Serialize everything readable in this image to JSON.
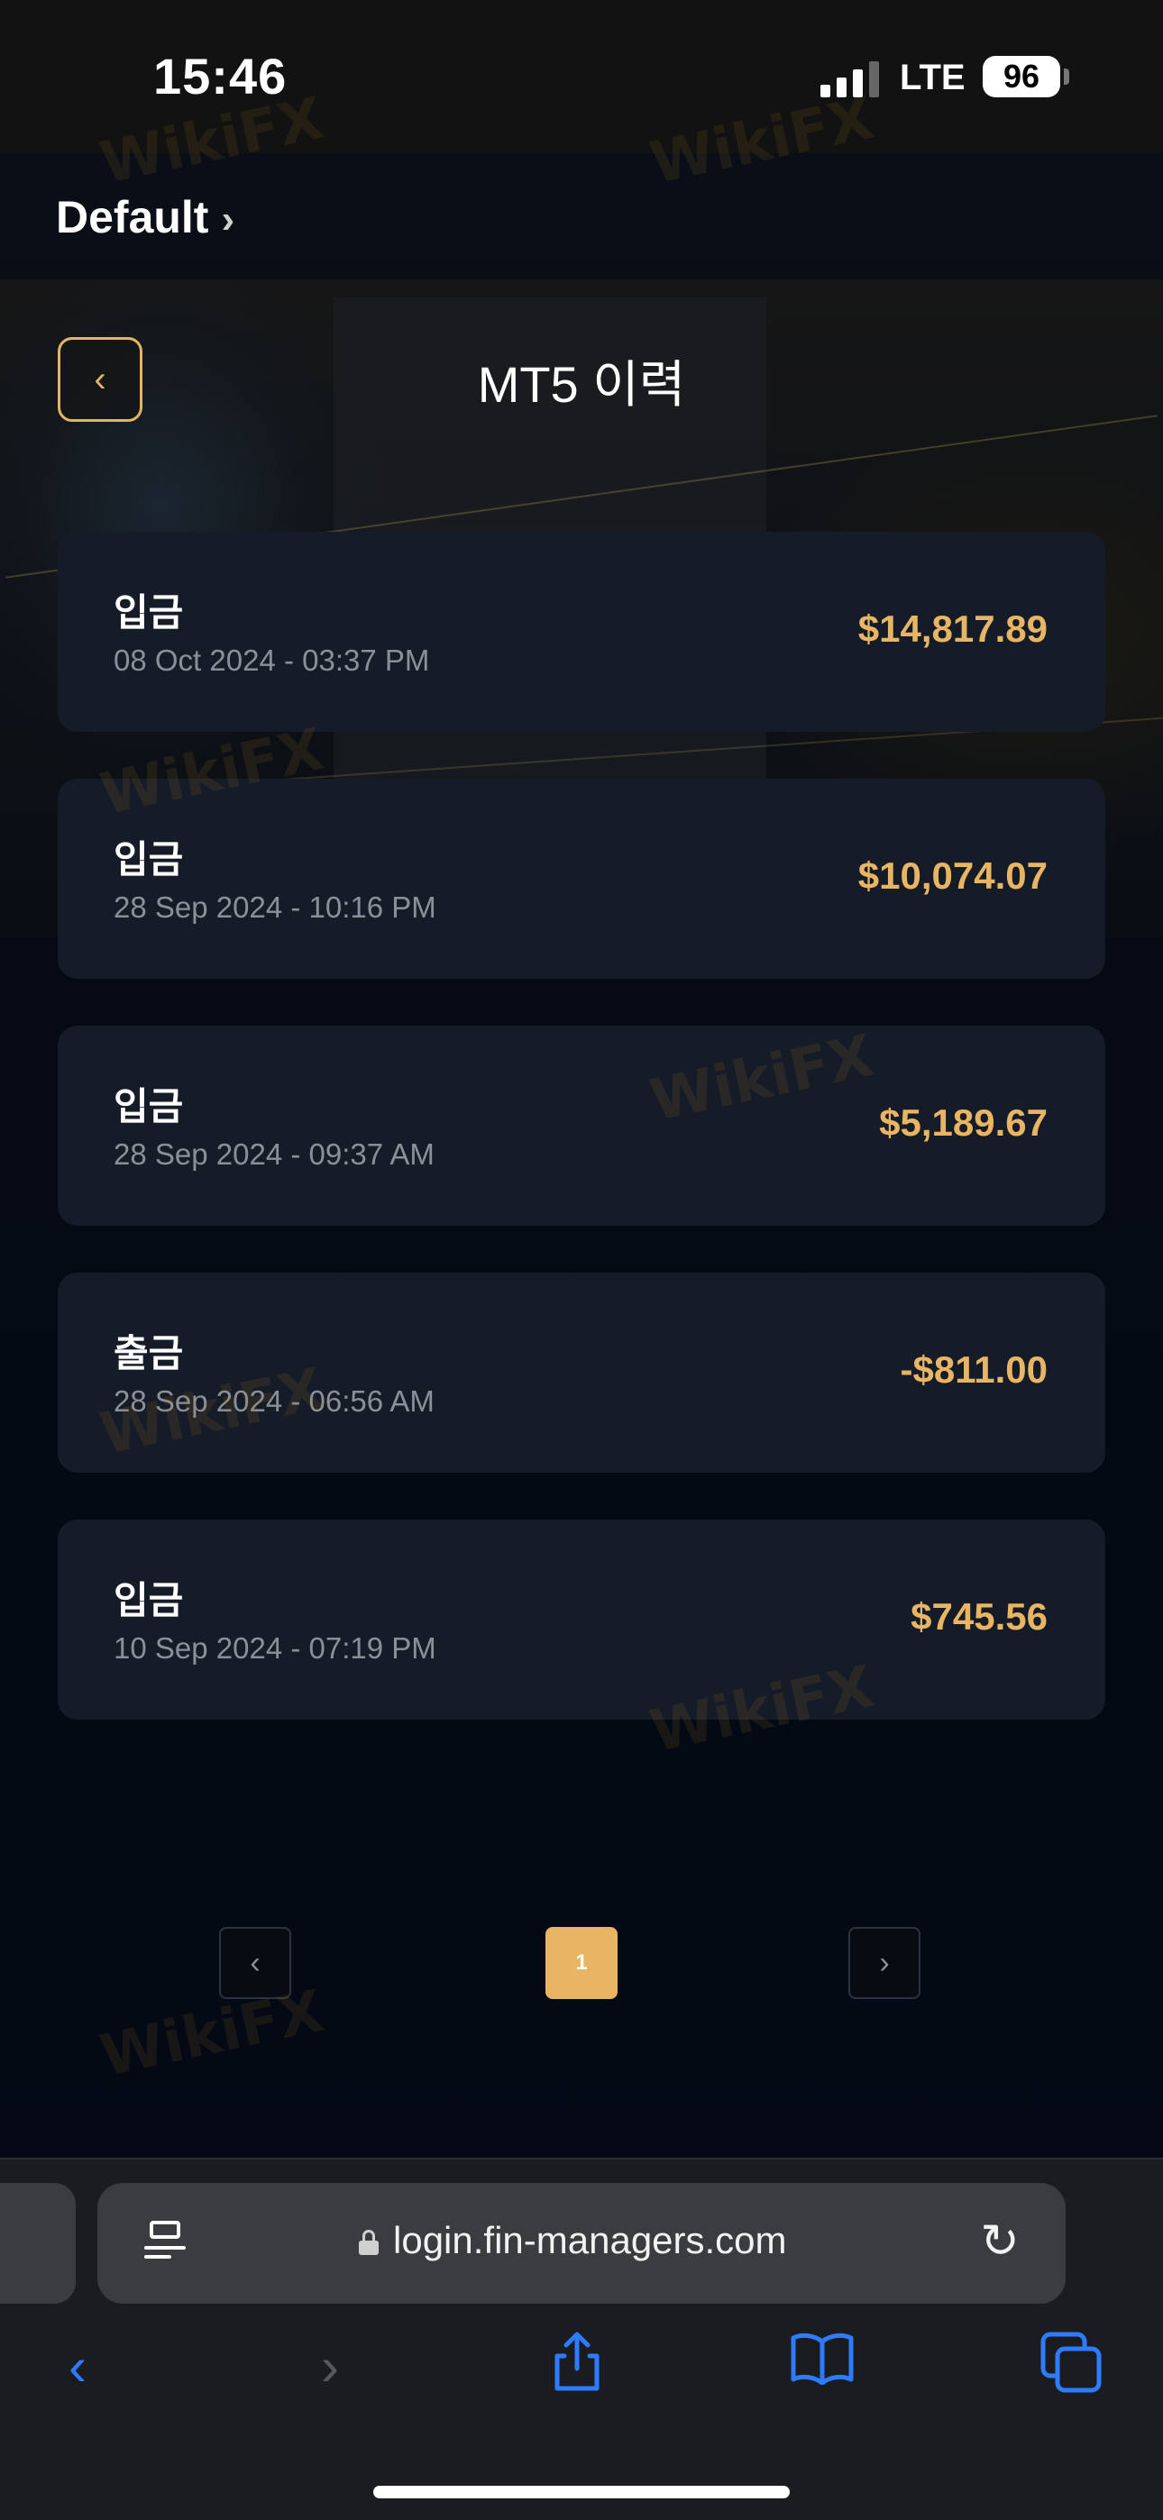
{
  "status": {
    "time": "15:46",
    "network": "LTE",
    "battery": "96"
  },
  "workspace": {
    "label": "Default",
    "chevron_icon": "chevron-right-icon"
  },
  "header": {
    "title": "MT5 이력",
    "back_icon": "chevron-left-icon",
    "accent_color": "#e1b563"
  },
  "transactions": [
    {
      "type": "입금",
      "date": "08 Oct 2024 - 03:37 PM",
      "amount": "$14,817.89"
    },
    {
      "type": "입금",
      "date": "28 Sep 2024 - 10:16 PM",
      "amount": "$10,074.07"
    },
    {
      "type": "입금",
      "date": "28 Sep 2024 - 09:37 AM",
      "amount": "$5,189.67"
    },
    {
      "type": "출금",
      "date": "28 Sep 2024 - 06:56 AM",
      "amount": "-$811.00"
    },
    {
      "type": "입금",
      "date": "10 Sep 2024 - 07:19 PM",
      "amount": "$745.56"
    }
  ],
  "pagination": {
    "prev_icon": "chevron-left-icon",
    "current_page": "1",
    "next_icon": "chevron-right-icon"
  },
  "browser": {
    "url": "login.fin-managers.com",
    "reader_icon": "reader-icon",
    "lock_icon": "lock-icon",
    "reload_icon": "reload-icon",
    "toolbar_icons": [
      "back-icon",
      "forward-icon",
      "share-icon",
      "bookmarks-icon",
      "tabs-icon"
    ],
    "link_color": "#2f7bff"
  },
  "watermark": "WikiFX"
}
